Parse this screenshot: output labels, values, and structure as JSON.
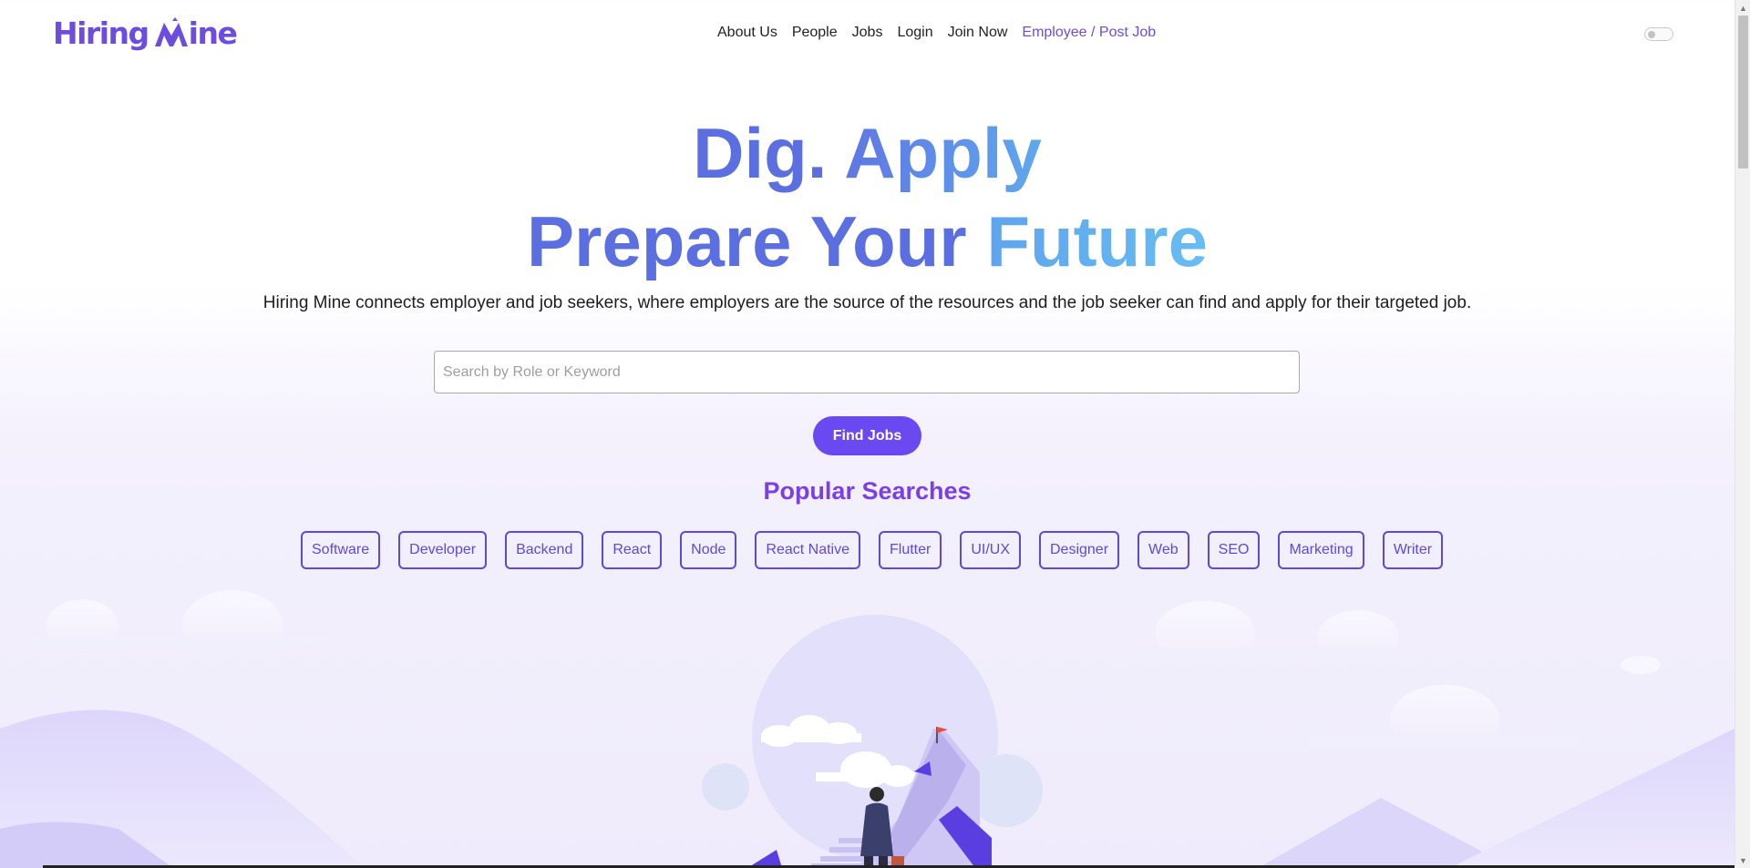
{
  "brand": {
    "logo_text_left": "Hiring",
    "logo_text_right": "ine",
    "accent_color": "#6c4de0"
  },
  "nav": {
    "items": [
      {
        "label": "About Us"
      },
      {
        "label": "People"
      },
      {
        "label": "Jobs"
      },
      {
        "label": "Login"
      },
      {
        "label": "Join Now"
      }
    ],
    "employer_link": "Employee / Post Job",
    "theme_toggle": "off"
  },
  "hero": {
    "line1_word1": "Dig.",
    "line1_word2": "Apply",
    "line2_word1": "Prepare",
    "line2_word2": "Your",
    "line2_word3": "Future",
    "subtitle": "Hiring Mine connects employer and job seekers, where employers are the source of the resources and the job seeker can find and apply for their targeted job."
  },
  "search": {
    "placeholder": "Search by Role or Keyword",
    "value": "",
    "button_label": "Find Jobs"
  },
  "popular": {
    "title": "Popular Searches",
    "tags": [
      "Software",
      "Developer",
      "Backend",
      "React",
      "Node",
      "React Native",
      "Flutter",
      "UI/UX",
      "Designer",
      "Web",
      "SEO",
      "Marketing",
      "Writer"
    ]
  },
  "colors": {
    "primary_button": "#6a4af0",
    "title_blue": "#5b6fe0",
    "title_light_blue": "#67bdf2",
    "popular_title": "#7b3fe6"
  }
}
